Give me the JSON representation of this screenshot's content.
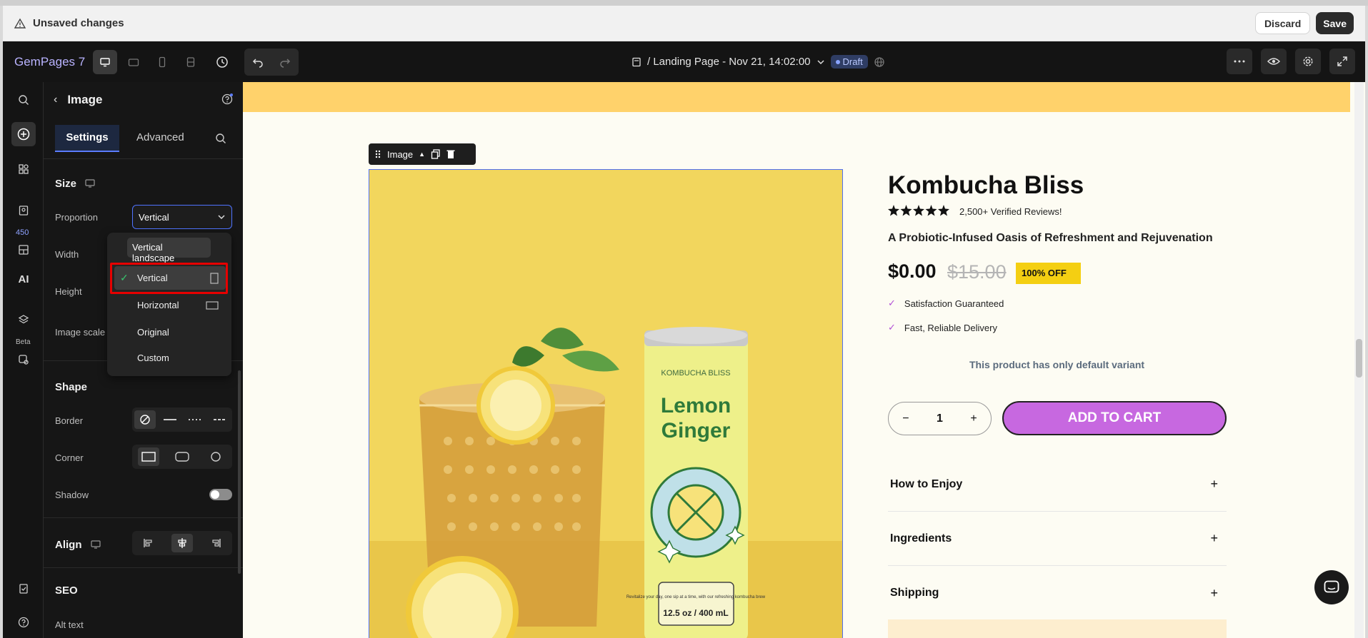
{
  "unsaved_bar": {
    "message": "Unsaved changes",
    "discard_label": "Discard",
    "save_label": "Save"
  },
  "appbar": {
    "brand": "GemPages 7",
    "page_title": "/ Landing Page - Nov 21, 14:02:00",
    "status_badge": "Draft"
  },
  "rail": {
    "badge_count": "450",
    "ai_label": "AI",
    "beta_label": "Beta"
  },
  "panel": {
    "title": "Image",
    "tabs": {
      "settings": "Settings",
      "advanced": "Advanced"
    },
    "size_section": "Size",
    "proportion_label": "Proportion",
    "proportion_value": "Vertical",
    "width_label": "Width",
    "height_label": "Height",
    "image_scale_label": "Image scale",
    "shape_section": "Shape",
    "border_label": "Border",
    "corner_label": "Corner",
    "shadow_label": "Shadow",
    "align_section": "Align",
    "seo_section": "SEO",
    "alt_text_label": "Alt text"
  },
  "proportion_dropdown": {
    "tooltip": "Vertical landscape",
    "options": [
      "Vertical",
      "Horizontal",
      "Original",
      "Custom"
    ],
    "selected": "Vertical"
  },
  "canvas": {
    "image_toolbar_label": "Image",
    "product": {
      "name": "Kombucha Bliss",
      "reviews": "2,500+ Verified Reviews!",
      "rating": 5,
      "tagline": "A Probiotic-Infused Oasis of Refreshment and Rejuvenation",
      "price": "$0.00",
      "old_price": "$15.00",
      "discount": "100% OFF",
      "features": [
        "Satisfaction Guaranteed",
        "Fast, Reliable Delivery"
      ],
      "variant_note": "This product has only default variant",
      "quantity": "1",
      "add_to_cart": "ADD TO CART",
      "accordions": [
        "How to Enjoy",
        "Ingredients",
        "Shipping"
      ]
    },
    "can": {
      "brand": "KOMBUCHA BLISS",
      "flavor_line1": "Lemon",
      "flavor_line2": "Ginger",
      "tagline": "Revitalize your day, one sip at a time, with our refreshing kombucha brew",
      "volume": "12.5 oz / 400 mL"
    }
  },
  "colors": {
    "accent": "#c768e0",
    "band": "#ffd26b",
    "discount_badge": "#f4cf12",
    "editor_blue": "#4f73ff"
  }
}
